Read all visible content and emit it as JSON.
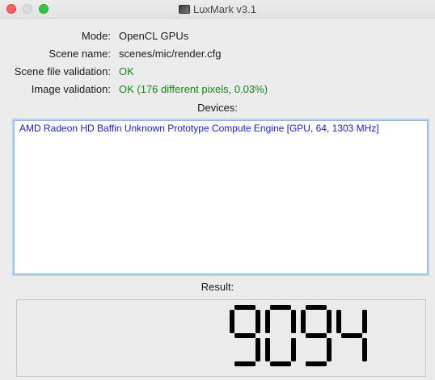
{
  "window": {
    "title": "LuxMark v3.1"
  },
  "info": [
    {
      "label": "Mode:",
      "value": "OpenCL GPUs",
      "status": "normal"
    },
    {
      "label": "Scene name:",
      "value": "scenes/mic/render.cfg",
      "status": "normal"
    },
    {
      "label": "Scene file validation:",
      "value": "OK",
      "status": "ok"
    },
    {
      "label": "Image validation:",
      "value": "OK (176 different pixels, 0.03%)",
      "status": "ok"
    }
  ],
  "devices": {
    "label": "Devices:",
    "items": [
      "AMD Radeon HD Baffin Unknown Prototype Compute Engine [GPU, 64, 1303 MHz]"
    ]
  },
  "result": {
    "label": "Result:",
    "score": "9094"
  },
  "colors": {
    "ok_text": "#118a11",
    "device_text": "#1c1cd2",
    "lcd_digit": "#000000"
  }
}
